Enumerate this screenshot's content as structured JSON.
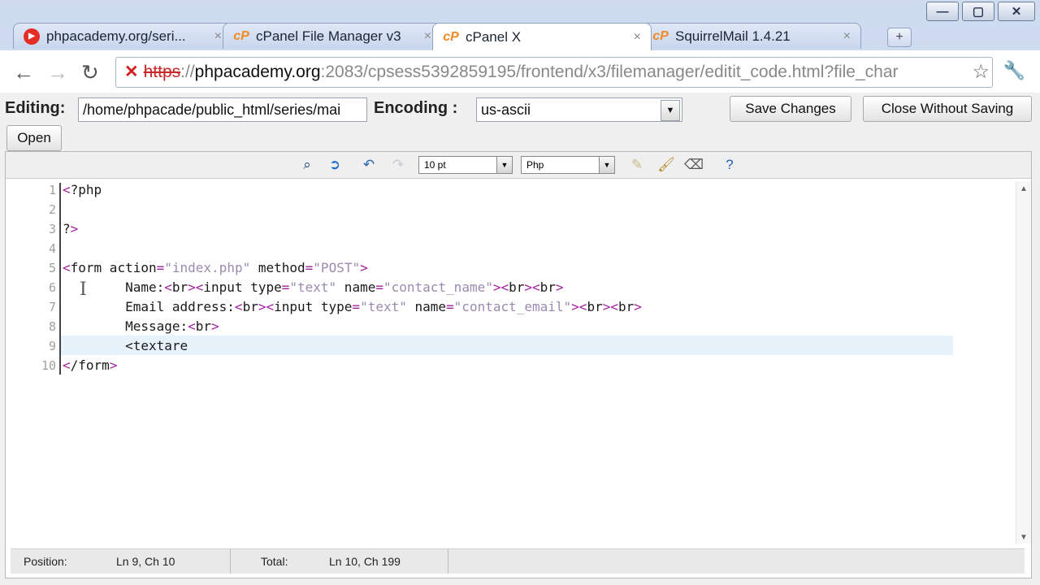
{
  "window": {
    "minimize": "—",
    "maximize": "▢",
    "close": "✕"
  },
  "tabs": [
    {
      "label": "phpacademy.org/seri...",
      "icon": "youtube-icon",
      "active": false
    },
    {
      "label": "cPanel File Manager v3",
      "icon": "cpanel-icon",
      "active": false
    },
    {
      "label": "cPanel X",
      "icon": "cpanel-icon",
      "active": true
    },
    {
      "label": "SquirrelMail 1.4.21",
      "icon": "cpanel-icon",
      "active": false
    }
  ],
  "tab_close": "×",
  "new_tab": "+",
  "nav": {
    "back": "←",
    "forward": "→",
    "reload": "↻"
  },
  "url": {
    "scheme": "https",
    "sep": "://",
    "host": "phpacademy.org",
    "path": ":2083/cpsess5392859195/frontend/x3/filemanager/editit_code.html?file_char"
  },
  "editor_bar": {
    "editing_label": "Editing:",
    "editing_path": "/home/phpacade/public_html/series/mai",
    "encoding_label": "Encoding :",
    "encoding_value": "us-ascii",
    "save_label": "Save Changes",
    "close_label": "Close Without Saving",
    "open_label": "Open"
  },
  "edit_toolbar": {
    "font_size": "10 pt",
    "syntax": "Php"
  },
  "code": {
    "line_numbers": [
      "1",
      "2",
      "3",
      "4",
      "5",
      "6",
      "7",
      "8",
      "9",
      "10"
    ],
    "current_line": 9
  },
  "status": {
    "position_label": "Position:",
    "position_value": "Ln 9, Ch 10",
    "total_label": "Total:",
    "total_value": "Ln 10, Ch 199"
  }
}
